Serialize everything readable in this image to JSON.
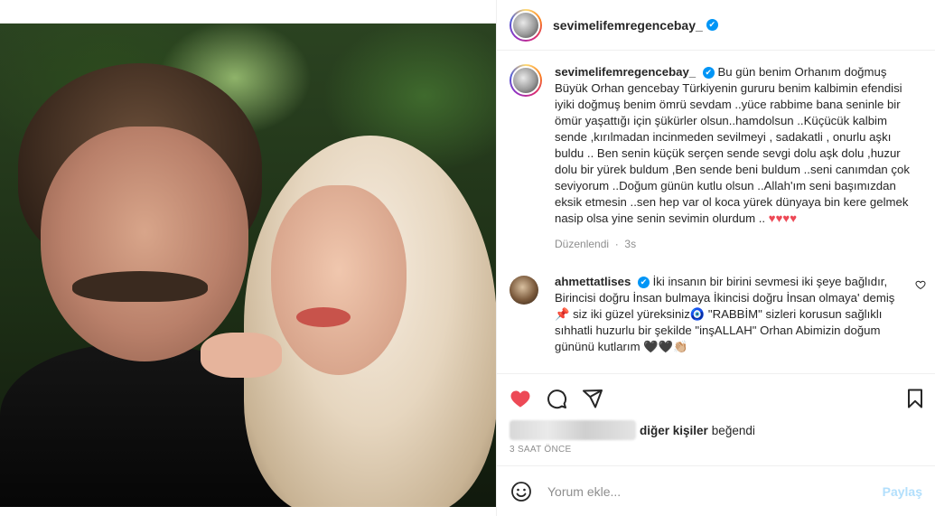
{
  "post": {
    "username": "sevimelifemregencebay_",
    "verified_symbol": "✔"
  },
  "caption": {
    "username": "sevimelifemregencebay_",
    "text": "Bu gün benim Orhanım doğmuş Büyük Orhan gencebay Türkiyenin gururu benim kalbimin efendisi iyiki doğmuş benim ömrü sevdam ..yüce rabbime bana seninle bir ömür yaşattığı için şükürler olsun..hamdolsun ..Küçücük kalbim sende ,kırılmadan incinmeden sevilmeyi , sadakatli , onurlu aşkı buldu .. Ben senin küçük serçen sende sevgi dolu aşk dolu ,huzur dolu bir yürek buldum ,Ben sende beni buldum ..seni canımdan çok seviyorum ..Doğum günün kutlu olsun ..Allah'ım seni başımızdan eksik etmesin ..sen hep var ol koca yürek dünyaya bin kere gelmek nasip olsa yine senin sevimin olurdum ..",
    "hearts": "♥♥♥♥",
    "edited_label": "Düzenlendi",
    "age": "3s"
  },
  "comment": {
    "username": "ahmettatlises",
    "text": "İki insanın bir birini sevmesi iki şeye bağlıdır, Birincisi doğru İnsan bulmaya İkincisi doğru İnsan olmaya' demiş📌 siz iki güzel yüreksiniz🧿 \"RABBİM\" sizleri korusun sağlıklı sıhhatli huzurlu bir şekilde \"inşALLAH\" Orhan Abimizin doğum gününü kutlarım 🖤🖤👏🏼"
  },
  "likes": {
    "others_label": "diğer kişiler",
    "liked_label": "beğendi"
  },
  "timestamp": "3 SAAT ÖNCE",
  "add_comment": {
    "placeholder": "Yorum ekle...",
    "post_label": "Paylaş"
  },
  "colors": {
    "like_red": "#ed4956",
    "verified_blue": "#0095f6",
    "post_button": "#b2dffc"
  },
  "icons": [
    "heart-icon",
    "comment-icon",
    "share-icon",
    "bookmark-icon",
    "emoji-icon",
    "verified-icon"
  ]
}
